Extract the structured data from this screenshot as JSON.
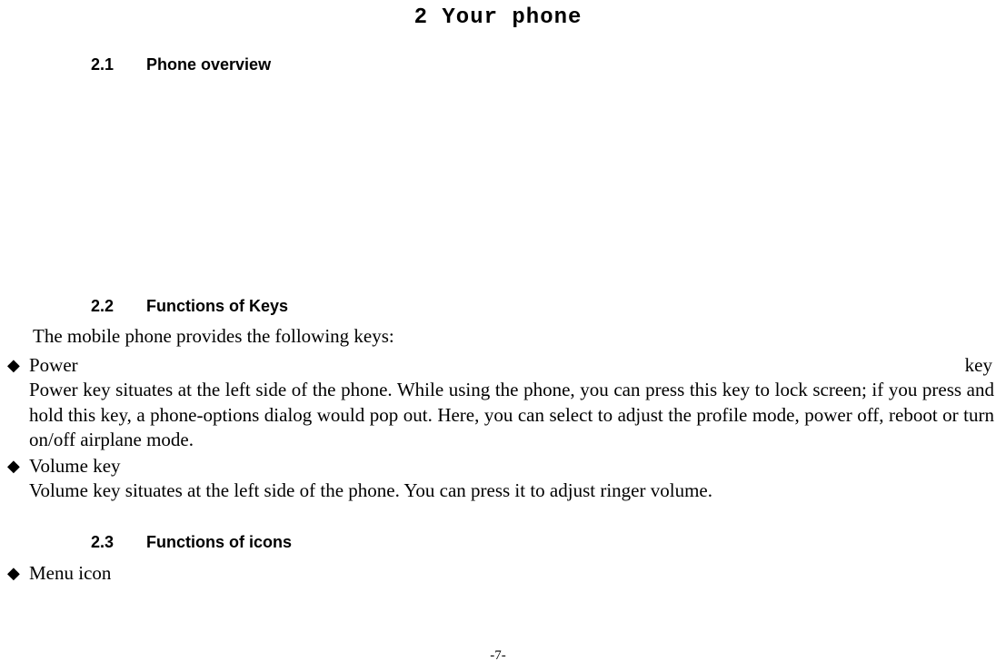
{
  "chapter": {
    "number": "2",
    "title": "Your phone",
    "full": "2 Your phone"
  },
  "sections": {
    "s21": {
      "num": "2.1",
      "title": "Phone overview"
    },
    "s22": {
      "num": "2.2",
      "title": "Functions of Keys",
      "intro": "The mobile phone provides the following keys:",
      "items": [
        {
          "label_left": "Power",
          "label_right": "key",
          "desc": "Power key situates at the left side of the phone. While using the phone, you can press this key to lock screen; if you press and hold this key, a phone-options dialog would pop out. Here, you can select to adjust the profile mode, power off, reboot or turn on/off airplane mode."
        },
        {
          "label": "Volume key",
          "desc": "Volume key situates at the left side of the phone. You can press it to adjust ringer volume."
        }
      ]
    },
    "s23": {
      "num": "2.3",
      "title": "Functions of icons",
      "items": [
        {
          "label": "Menu icon"
        }
      ]
    }
  },
  "page_number": "-7-"
}
